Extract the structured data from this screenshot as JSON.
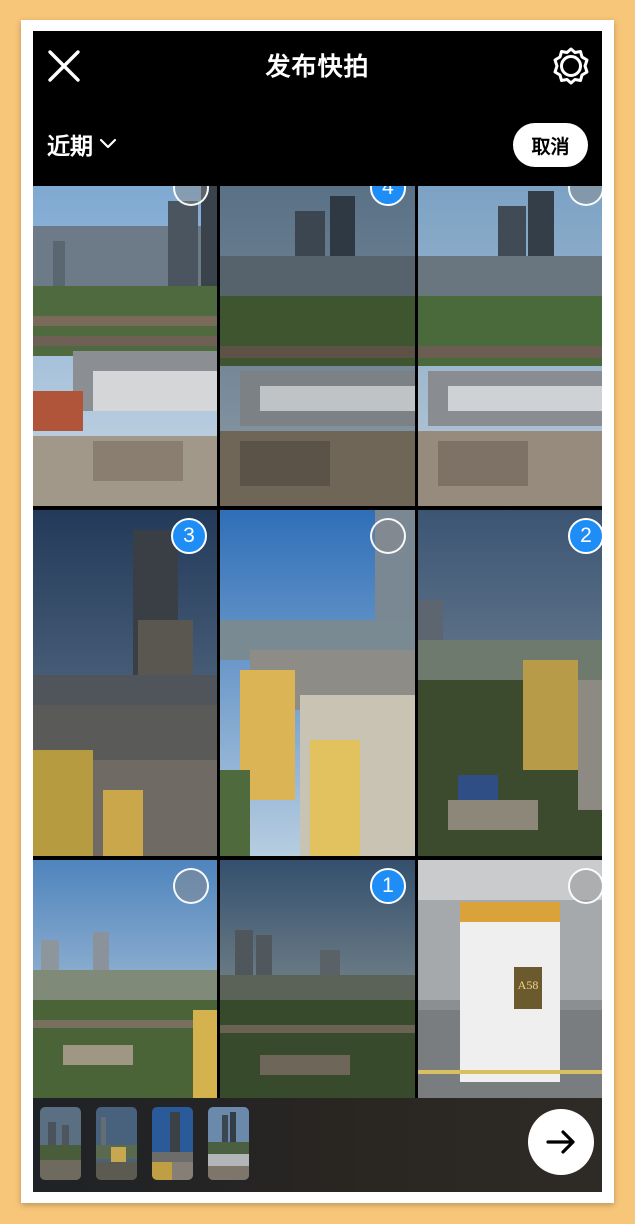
{
  "header": {
    "title": "发布快拍",
    "close_icon": "close-icon",
    "settings_icon": "gear-icon"
  },
  "subheader": {
    "album_label": "近期",
    "album_icon": "chevron-down-icon",
    "cancel_label": "取消"
  },
  "grid": {
    "photos": [
      {
        "name": "photo-city-skyline-1",
        "selection": ""
      },
      {
        "name": "photo-city-skyline-2",
        "selection": "4"
      },
      {
        "name": "photo-city-skyline-3",
        "selection": ""
      },
      {
        "name": "photo-tower-mall-1",
        "selection": "3"
      },
      {
        "name": "photo-tower-mall-2",
        "selection": ""
      },
      {
        "name": "photo-mall-park",
        "selection": "2"
      },
      {
        "name": "photo-city-view-1",
        "selection": ""
      },
      {
        "name": "photo-city-view-2",
        "selection": "1"
      },
      {
        "name": "photo-parking-garage",
        "selection": ""
      }
    ],
    "parking_sign": "A58"
  },
  "tray": {
    "selected_count": 4,
    "next_icon": "arrow-right-icon"
  },
  "colors": {
    "background": "#f8c678",
    "selection_badge": "#1e8ef6",
    "screen": "#000000"
  }
}
